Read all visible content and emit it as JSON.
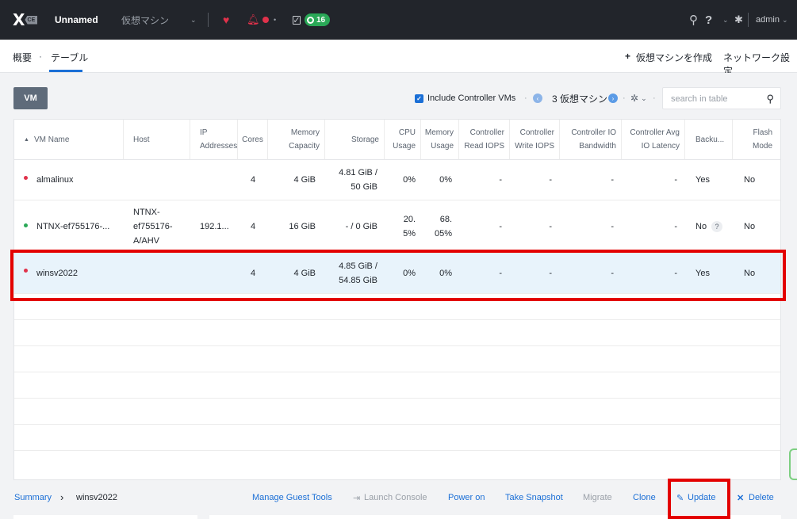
{
  "topbar": {
    "logo_mark": "X",
    "logo_badge": "CE",
    "cluster_name": "Unnamed",
    "nav_menu": "仮想マシン",
    "tasks_count": "16",
    "user": "admin"
  },
  "subheader": {
    "tab_overview": "概要",
    "tab_separator": "·",
    "tab_table": "テーブル",
    "create_vm": "仮想マシンを作成",
    "network_config": "ネットワーク設定"
  },
  "toolbar": {
    "vm_button": "VM",
    "include_controller": "Include Controller VMs",
    "vm_count": "3 仮想マシン",
    "search_placeholder": "search in table"
  },
  "columns": [
    [
      "VM Name"
    ],
    [
      "Host"
    ],
    [
      "IP",
      "Addresses"
    ],
    [
      "Cores"
    ],
    [
      "Memory",
      "Capacity"
    ],
    [
      "Storage"
    ],
    [
      "CPU",
      "Usage"
    ],
    [
      "Memory",
      "Usage"
    ],
    [
      "Controller",
      "Read IOPS"
    ],
    [
      "Controller",
      "Write IOPS"
    ],
    [
      "Controller IO",
      "Bandwidth"
    ],
    [
      "Controller Avg",
      "IO Latency"
    ],
    [
      "Backu..."
    ],
    [
      "Flash",
      "Mode"
    ]
  ],
  "rows": [
    {
      "status": "red",
      "name": "almalinux",
      "host": [],
      "ip": "",
      "cores": "4",
      "memory": "4 GiB",
      "storage": [
        "4.81 GiB /",
        "50 GiB"
      ],
      "cpu": [
        "0%"
      ],
      "mem_usage": [
        "0%"
      ],
      "read_iops": "-",
      "write_iops": "-",
      "io_bw": "-",
      "io_lat": "-",
      "backup": "Yes",
      "flash": "No"
    },
    {
      "status": "green",
      "name": "NTNX-ef755176-...",
      "host": [
        "NTNX-",
        "ef755176-",
        "A/AHV"
      ],
      "ip": "192.1...",
      "cores": "4",
      "memory": "16 GiB",
      "storage": [
        "- / 0 GiB"
      ],
      "cpu": [
        "20.",
        "5%"
      ],
      "mem_usage": [
        "68.",
        "05%"
      ],
      "read_iops": "-",
      "write_iops": "-",
      "io_bw": "-",
      "io_lat": "-",
      "backup": "No",
      "backup_help": "?",
      "flash": "No"
    },
    {
      "status": "red",
      "name": "winsv2022",
      "host": [],
      "ip": "",
      "cores": "4",
      "memory": "4 GiB",
      "storage": [
        "4.85 GiB /",
        "54.85 GiB"
      ],
      "cpu": [
        "0%"
      ],
      "mem_usage": [
        "0%"
      ],
      "read_iops": "-",
      "write_iops": "-",
      "io_bw": "-",
      "io_lat": "-",
      "backup": "Yes",
      "flash": "No"
    }
  ],
  "actions": {
    "breadcrumb_root": "Summary",
    "breadcrumb_sep": "›",
    "breadcrumb_current": "winsv2022",
    "manage_guest_tools": "Manage Guest Tools",
    "launch_console": "Launch Console",
    "power_on": "Power on",
    "take_snapshot": "Take Snapshot",
    "migrate": "Migrate",
    "clone": "Clone",
    "update": "Update",
    "delete": "Delete"
  },
  "colors": {
    "accent": "#1b6fd6",
    "status_red": "#e0324b",
    "status_green": "#2aa857",
    "highlight": "#e30000"
  }
}
